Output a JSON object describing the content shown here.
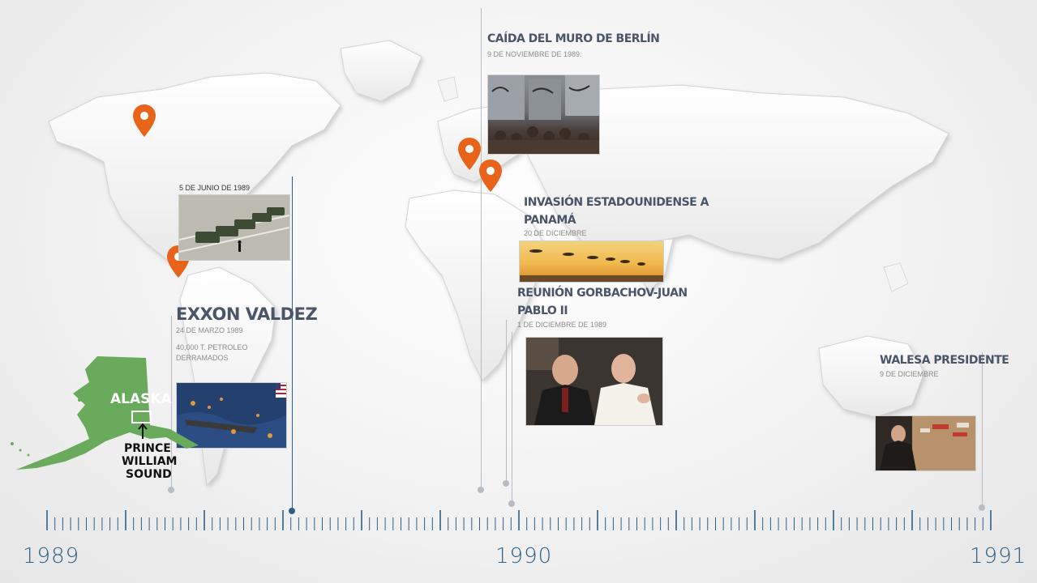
{
  "colors": {
    "accent": "#e8641b",
    "timeline": "#2f5f86",
    "title": "#4a5568",
    "alaska": "#6aaa5c"
  },
  "events": {
    "berlin": {
      "title": "Caída del muro de Berlín",
      "date": "9 de noviembre de 1989."
    },
    "tiananmen": {
      "date": "5 de junio de 1989"
    },
    "panama": {
      "title_line1": "Invasión Estadounidense a",
      "title_line2": "Panamá",
      "date": "20 de diciembre"
    },
    "gorbachov": {
      "title_line1": "Reunión Gorbachov-Juan",
      "title_line2": "Pablo II",
      "date": "1 de diciembre  de 1989"
    },
    "exxon": {
      "title": "Exxon Valdez",
      "date": "24 de marzo 1989",
      "note_line1": "40,000 t. petroleo",
      "note_line2": "derramados"
    },
    "walesa": {
      "title": "Walesa presidente",
      "date": "9 de diciembre"
    }
  },
  "alaska_map": {
    "state": "ALASKA",
    "sound_line1": "PRINCE",
    "sound_line2": "WILLIAM",
    "sound_line3": "SOUND"
  },
  "years": {
    "start": "1989",
    "middle": "1990",
    "end": "1991"
  },
  "icons": {
    "pin": "map-pin-icon",
    "arrow": "arrow-up-icon",
    "flag": "us-flag-icon"
  }
}
